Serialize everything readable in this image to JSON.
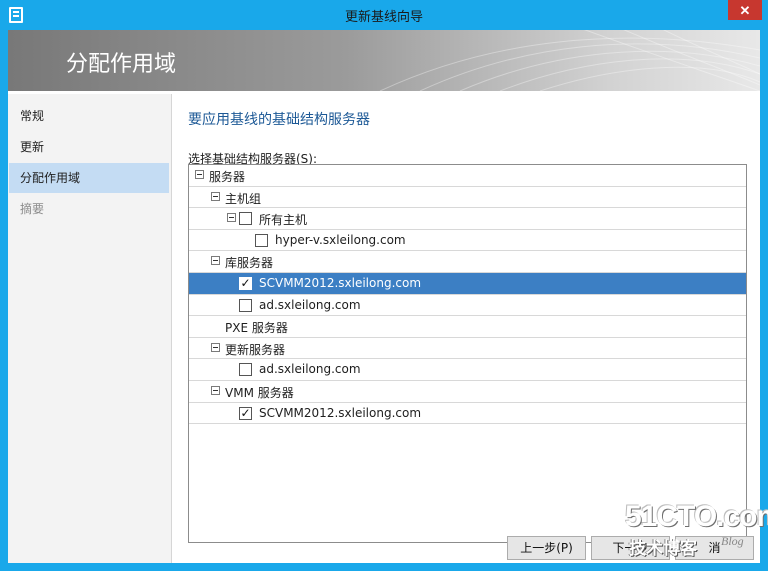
{
  "window": {
    "title": "更新基线向导",
    "close_label": "✕"
  },
  "banner": {
    "title": "分配作用域"
  },
  "nav": {
    "items": [
      {
        "label": "常规",
        "state": "normal"
      },
      {
        "label": "更新",
        "state": "normal"
      },
      {
        "label": "分配作用域",
        "state": "selected"
      },
      {
        "label": "摘要",
        "state": "disabled"
      }
    ]
  },
  "main": {
    "heading": "要应用基线的基础结构服务器",
    "select_label": "选择基础结构服务器(S):",
    "tree": [
      {
        "label": "服务器",
        "level": 0,
        "expander": true,
        "checkbox": false,
        "checked": false,
        "selected": false
      },
      {
        "label": "主机组",
        "level": 1,
        "expander": true,
        "checkbox": false,
        "checked": false,
        "selected": false
      },
      {
        "label": "所有主机",
        "level": 2,
        "expander": true,
        "checkbox": true,
        "checked": false,
        "selected": false
      },
      {
        "label": "hyper-v.sxleilong.com",
        "level": 3,
        "expander": false,
        "checkbox": true,
        "checked": false,
        "selected": false
      },
      {
        "label": "库服务器",
        "level": 1,
        "expander": true,
        "checkbox": false,
        "checked": false,
        "selected": false
      },
      {
        "label": "SCVMM2012.sxleilong.com",
        "level": 2,
        "expander": false,
        "checkbox": true,
        "checked": true,
        "selected": true
      },
      {
        "label": "ad.sxleilong.com",
        "level": 2,
        "expander": false,
        "checkbox": true,
        "checked": false,
        "selected": false
      },
      {
        "label": "PXE 服务器",
        "level": 1,
        "expander": false,
        "checkbox": false,
        "checked": false,
        "selected": false
      },
      {
        "label": "更新服务器",
        "level": 1,
        "expander": true,
        "checkbox": false,
        "checked": false,
        "selected": false
      },
      {
        "label": "ad.sxleilong.com",
        "level": 2,
        "expander": false,
        "checkbox": true,
        "checked": false,
        "selected": false
      },
      {
        "label": "VMM 服务器",
        "level": 1,
        "expander": true,
        "checkbox": false,
        "checked": false,
        "selected": false
      },
      {
        "label": "SCVMM2012.sxleilong.com",
        "level": 2,
        "expander": false,
        "checkbox": true,
        "checked": true,
        "selected": false
      }
    ]
  },
  "buttons": {
    "previous": "上一步(P)",
    "next": "下一步",
    "cancel": "消"
  },
  "watermark": {
    "site": "51CTO.com",
    "tagline": "技术博客",
    "blog": "Blog"
  },
  "colors": {
    "titlebar": "#19a8ea",
    "selection": "#3c7fc4",
    "heading": "#1d5996",
    "nav_selected": "#c4dcf3"
  }
}
